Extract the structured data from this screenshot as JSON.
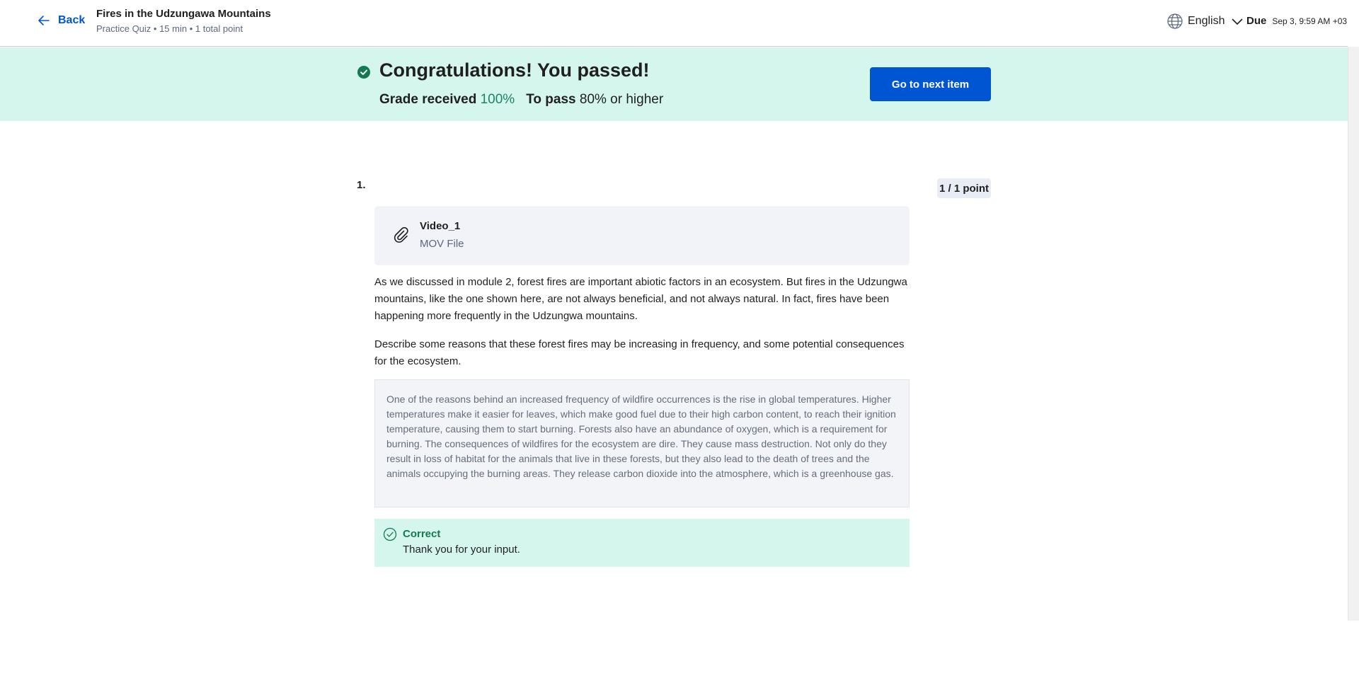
{
  "header": {
    "back_label": "Back",
    "title": "Fires in the Udzungawa Mountains",
    "subtitle": "Practice Quiz • 15 min • 1 total point",
    "language": "English",
    "due_label": "Due",
    "due_date": "Sep 3, 9:59 AM +03"
  },
  "banner": {
    "heading": "Congratulations! You passed!",
    "grade_label": "Grade received",
    "grade_value": "100%",
    "pass_label": "To pass",
    "pass_value": "80% or higher",
    "next_button": "Go to next item"
  },
  "question": {
    "number": "1.",
    "points": "1 / 1 point",
    "attachment": {
      "name": "Video_1",
      "type": "MOV File"
    },
    "paragraphs": [
      "As we discussed in module 2, forest fires are important abiotic factors in an ecosystem. But fires in the Udzungwa mountains, like the one shown here, are not always beneficial, and not always natural. In fact, fires have been happening more frequently in the Udzungwa mountains.",
      " Describe some reasons that these forest fires may be increasing in frequency, and some potential consequences for the ecosystem."
    ],
    "answer": "One of the reasons behind an increased frequency of wildfire occurrences is the rise in global temperatures. Higher temperatures make it easier for leaves, which make good fuel due to their high carbon content, to reach their ignition temperature, causing them to start burning. Forests also have an abundance of oxygen, which is a requirement for burning. The consequences of wildfires for the ecosystem are dire. They cause mass destruction. Not only do they result in loss of habitat for the animals that live in these forests, but they also lead to the death of trees and the animals occupying the burning areas. They release carbon dioxide into the atmosphere, which is a greenhouse gas.",
    "feedback": {
      "status": "Correct",
      "message": "Thank you for your input."
    }
  },
  "colors": {
    "accent": "#0056d2",
    "success_bg": "#d5f6ec",
    "success_text": "#137a52",
    "grade_green": "#1b8560"
  }
}
